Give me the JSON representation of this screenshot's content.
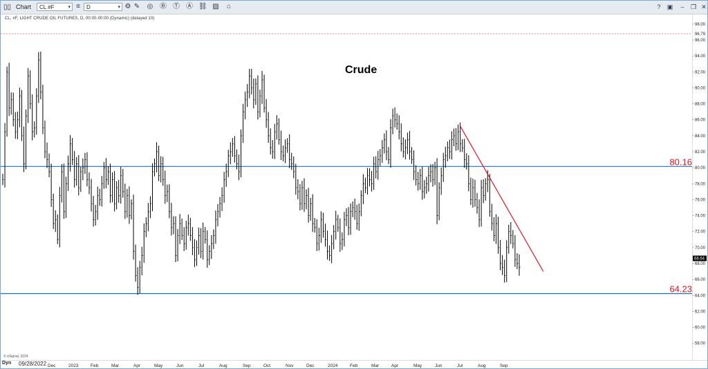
{
  "window": {
    "title": "Chart",
    "symbol": "CL #F",
    "interval": "D"
  },
  "toolbar": {
    "tools": [
      {
        "icon": "pencil-icon",
        "glyph": "✎"
      },
      {
        "icon": "cycle-icon",
        "glyph": "◎"
      },
      {
        "icon": "b-circle-icon",
        "glyph": "Ⓑ"
      },
      {
        "icon": "t-circle-icon",
        "glyph": "Ⓣ"
      },
      {
        "icon": "a-circle-icon",
        "glyph": "Ⓐ"
      },
      {
        "icon": "link-icon",
        "glyph": "⛓"
      },
      {
        "icon": "image-icon",
        "glyph": "▨"
      },
      {
        "icon": "tag-icon",
        "glyph": "⌂"
      }
    ],
    "window_controls": [
      {
        "icon": "help-icon",
        "glyph": "?"
      },
      {
        "icon": "layout-icon",
        "glyph": "▣"
      },
      {
        "icon": "minimize-icon",
        "glyph": "–"
      },
      {
        "icon": "restore-icon",
        "glyph": "❐"
      },
      {
        "icon": "close-icon",
        "glyph": "✕"
      }
    ]
  },
  "chart_meta": "CL, #F, LIGHT CRUDE OIL FUTURES, D, 00:00-00:00 (Dynamic) (delayed 10)",
  "bottom_bar": {
    "mode": "Dyn",
    "start_date": "09/28/2022"
  },
  "credit": "© eSignal, 2024",
  "chart_data": {
    "type": "bar",
    "title": "Crude",
    "ylim": [
      55.9,
      99.2
    ],
    "yticks": [
      "58.00",
      "60.00",
      "62.00",
      "64.00",
      "66.00",
      "68.00",
      "70.00",
      "72.00",
      "74.00",
      "76.00",
      "78.00",
      "80.00",
      "82.00",
      "84.00",
      "86.00",
      "88.00",
      "90.00",
      "92.00",
      "94.00",
      "96.00",
      "98.00"
    ],
    "last_price": "68.64",
    "red_dashed_level": "96.79",
    "months": [
      "Dec",
      "2023",
      "Feb",
      "Mar",
      "Apr",
      "May",
      "Jun",
      "Jul",
      "Aug",
      "Sep",
      "Oct",
      "Nov",
      "Dec",
      "2024",
      "Feb",
      "Mar",
      "Apr",
      "May",
      "Jun",
      "Jul",
      "Aug",
      "Sep"
    ],
    "horizontal_lines": [
      {
        "value": 80.16,
        "label": "80.16",
        "color": "#1a73c8"
      },
      {
        "value": 64.23,
        "label": "64.23",
        "color": "#1a73c8"
      }
    ],
    "trendline": {
      "start": {
        "date": "2024-07-05",
        "value": 85.3
      },
      "end": {
        "date": "2024-10-31",
        "value": 67.0
      },
      "color": "#e0141c"
    },
    "start_date": "2022-09-28",
    "closes": [
      78.5,
      84.5,
      92.0,
      87.5,
      88.5,
      86.0,
      84.5,
      86.0,
      89.0,
      84.0,
      80.5,
      86.5,
      91.5,
      88.0,
      84.5,
      85.0,
      89.0,
      93.5,
      89.5,
      85.0,
      82.0,
      81.0,
      79.5,
      76.0,
      73.0,
      73.5,
      71.0,
      76.5,
      79.5,
      74.5,
      78.0,
      80.5,
      83.0,
      81.0,
      78.5,
      80.5,
      77.5,
      79.5,
      80.0,
      81.0,
      78.5,
      77.5,
      75.5,
      73.5,
      74.5,
      76.5,
      76.0,
      78.0,
      80.0,
      78.5,
      79.5,
      76.5,
      78.5,
      75.5,
      77.5,
      76.5,
      79.0,
      77.0,
      74.5,
      76.5,
      74.0,
      75.5,
      69.5,
      66.5,
      65.0,
      67.5,
      69.0,
      72.0,
      73.0,
      74.5,
      75.5,
      79.5,
      80.5,
      82.0,
      79.0,
      80.5,
      78.5,
      76.5,
      77.0,
      74.5,
      72.5,
      73.0,
      69.0,
      71.5,
      73.0,
      71.5,
      70.5,
      72.5,
      73.0,
      71.5,
      70.0,
      68.5,
      70.0,
      71.5,
      69.5,
      72.0,
      71.0,
      68.5,
      69.5,
      70.5,
      71.5,
      73.5,
      74.5,
      75.5,
      76.5,
      78.5,
      79.5,
      81.5,
      82.0,
      83.0,
      81.5,
      80.5,
      79.5,
      84.0,
      87.0,
      88.5,
      89.5,
      91.5,
      90.0,
      88.5,
      90.5,
      87.0,
      89.0,
      91.0,
      87.5,
      86.0,
      84.0,
      82.5,
      82.0,
      84.5,
      85.5,
      83.5,
      82.0,
      81.5,
      82.5,
      83.0,
      81.0,
      80.5,
      79.5,
      77.5,
      77.0,
      75.5,
      77.5,
      75.5,
      76.5,
      74.0,
      75.5,
      73.0,
      72.5,
      70.5,
      71.5,
      73.5,
      72.0,
      71.0,
      69.5,
      69.0,
      70.5,
      72.0,
      73.5,
      72.5,
      70.5,
      71.0,
      73.5,
      74.0,
      72.5,
      74.5,
      75.0,
      74.5,
      73.0,
      74.5,
      76.5,
      78.0,
      77.5,
      79.0,
      78.5,
      78.0,
      80.5,
      79.5,
      81.0,
      81.5,
      82.5,
      83.5,
      82.0,
      81.0,
      85.0,
      86.5,
      86.0,
      85.5,
      84.5,
      83.0,
      82.0,
      82.5,
      83.5,
      82.0,
      81.0,
      79.5,
      78.5,
      78.0,
      79.0,
      77.0,
      77.5,
      78.0,
      79.0,
      79.5,
      78.5,
      80.0,
      74.0,
      77.5,
      79.0,
      81.0,
      81.5,
      82.5,
      82.0,
      83.5,
      84.0,
      83.0,
      84.5,
      83.0,
      82.5,
      81.0,
      80.5,
      78.0,
      76.0,
      77.5,
      76.0,
      75.0,
      73.5,
      77.5,
      76.5,
      78.0,
      78.5,
      74.5,
      73.0,
      71.5,
      73.0,
      70.0,
      68.0,
      67.5,
      66.5,
      70.0,
      72.0,
      71.5,
      70.5,
      68.5,
      68.0,
      67.5
    ]
  }
}
